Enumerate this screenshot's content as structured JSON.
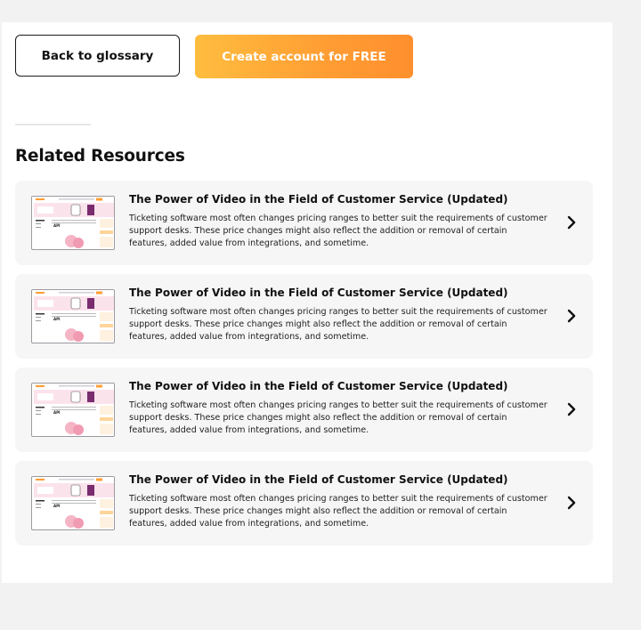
{
  "actions": {
    "back_label": "Back to glossary",
    "create_label": "Create account for FREE"
  },
  "related": {
    "title": "Related Resources",
    "items": [
      {
        "title": "The Power of Video in the Field of Customer Service (Updated)",
        "description": "Ticketing software most often changes pricing ranges to better suit the requirements of customer support desks. These price changes might also reflect the addition or removal of certain features, added value from integrations, and sometime.",
        "thumb_label": "API"
      },
      {
        "title": "The Power of Video in the Field of Customer Service (Updated)",
        "description": "Ticketing software most often changes pricing ranges to better suit the requirements of customer support desks. These price changes might also reflect the addition or removal of certain features, added value from integrations, and sometime.",
        "thumb_label": "API"
      },
      {
        "title": "The Power of Video in the Field of Customer Service (Updated)",
        "description": "Ticketing software most often changes pricing ranges to better suit the requirements of customer support desks. These price changes might also reflect the addition or removal of certain features, added value from integrations, and sometime.",
        "thumb_label": "API"
      },
      {
        "title": "The Power of Video in the Field of Customer Service (Updated)",
        "description": "Ticketing software most often changes pricing ranges to better suit the requirements of customer support desks. These price changes might also reflect the addition or removal of certain features, added value from integrations, and sometime.",
        "thumb_label": "API"
      }
    ]
  },
  "colors": {
    "accent_start": "#ffbd3f",
    "accent_end": "#ff8f2e",
    "card_bg": "#f6f6f7",
    "page_bg": "#f2f2f3"
  },
  "icons": {
    "card_arrow": "chevron-right-icon"
  }
}
